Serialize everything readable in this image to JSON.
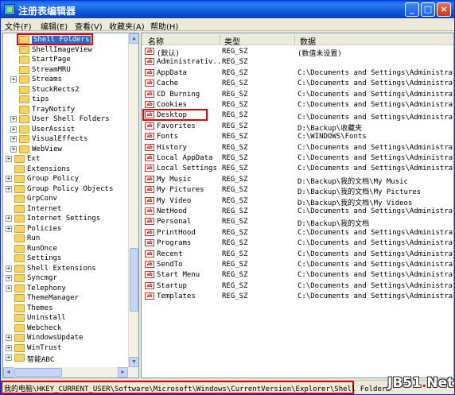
{
  "window": {
    "title": "注册表编辑器",
    "controls": {
      "minimize": "_",
      "maximize": "□",
      "close": "×"
    }
  },
  "menu": [
    "文件(F)",
    "编辑(E)",
    "查看(V)",
    "收藏夹(A)",
    "帮助(H)"
  ],
  "tree": {
    "items": [
      {
        "label": "Shell Folders",
        "indent": 1,
        "expander": "",
        "selected": true
      },
      {
        "label": "ShellImageView",
        "indent": 1,
        "expander": ""
      },
      {
        "label": "StartPage",
        "indent": 1,
        "expander": ""
      },
      {
        "label": "StreamMRU",
        "indent": 1,
        "expander": ""
      },
      {
        "label": "Streams",
        "indent": 1,
        "expander": "+"
      },
      {
        "label": "StuckRects2",
        "indent": 1,
        "expander": ""
      },
      {
        "label": "tips",
        "indent": 1,
        "expander": ""
      },
      {
        "label": "TrayNotify",
        "indent": 1,
        "expander": ""
      },
      {
        "label": "User Shell Folders",
        "indent": 1,
        "expander": "+"
      },
      {
        "label": "UserAssist",
        "indent": 1,
        "expander": "+"
      },
      {
        "label": "VisualEffects",
        "indent": 1,
        "expander": "+"
      },
      {
        "label": "WebView",
        "indent": 1,
        "expander": "+"
      },
      {
        "label": "Ext",
        "indent": 0,
        "expander": "+"
      },
      {
        "label": "Extensions",
        "indent": 0,
        "expander": ""
      },
      {
        "label": "Group Policy",
        "indent": 0,
        "expander": "+"
      },
      {
        "label": "Group Policy Objects",
        "indent": 0,
        "expander": "+"
      },
      {
        "label": "GrpConv",
        "indent": 0,
        "expander": ""
      },
      {
        "label": "Internet",
        "indent": 0,
        "expander": ""
      },
      {
        "label": "Internet Settings",
        "indent": 0,
        "expander": "+"
      },
      {
        "label": "Policies",
        "indent": 0,
        "expander": "+"
      },
      {
        "label": "Run",
        "indent": 0,
        "expander": ""
      },
      {
        "label": "RunOnce",
        "indent": 0,
        "expander": ""
      },
      {
        "label": "Settings",
        "indent": 0,
        "expander": ""
      },
      {
        "label": "Shell Extensions",
        "indent": 0,
        "expander": "+"
      },
      {
        "label": "Syncmgr",
        "indent": 0,
        "expander": "+"
      },
      {
        "label": "Telephony",
        "indent": 0,
        "expander": "+"
      },
      {
        "label": "ThemeManager",
        "indent": 0,
        "expander": ""
      },
      {
        "label": "Themes",
        "indent": 0,
        "expander": ""
      },
      {
        "label": "Uninstall",
        "indent": 0,
        "expander": ""
      },
      {
        "label": "Webcheck",
        "indent": 0,
        "expander": ""
      },
      {
        "label": "WindowsUpdate",
        "indent": 0,
        "expander": "+"
      },
      {
        "label": "WinTrust",
        "indent": 0,
        "expander": "+"
      },
      {
        "label": "智能ABC",
        "indent": 0,
        "expander": "+"
      }
    ]
  },
  "list": {
    "columns": {
      "name": "名称",
      "type": "类型",
      "data": "数据"
    },
    "rows": [
      {
        "name": "(默认)",
        "type": "REG_SZ",
        "data": "(数值未设置)"
      },
      {
        "name": "Administrativ...",
        "type": "REG_SZ",
        "data": ""
      },
      {
        "name": "AppData",
        "type": "REG_SZ",
        "data": "C:\\Documents and Settings\\Administrator\\A"
      },
      {
        "name": "Cache",
        "type": "REG_SZ",
        "data": "C:\\Documents and Settings\\Administrator\\L"
      },
      {
        "name": "CD Burning",
        "type": "REG_SZ",
        "data": "C:\\Documents and Settings\\Administrator\\L"
      },
      {
        "name": "Cookies",
        "type": "REG_SZ",
        "data": "C:\\Documents and Settings\\Administrator\\C"
      },
      {
        "name": "Desktop",
        "type": "REG_SZ",
        "data": "C:\\Documents and Settings\\Administrator\\桌",
        "highlight": true
      },
      {
        "name": "Favorites",
        "type": "REG_SZ",
        "data": "D:\\Backup\\收藏夹"
      },
      {
        "name": "Fonts",
        "type": "REG_SZ",
        "data": "C:\\WINDOWS\\Fonts"
      },
      {
        "name": "History",
        "type": "REG_SZ",
        "data": "C:\\Documents and Settings\\Administrator\\L"
      },
      {
        "name": "Local AppData",
        "type": "REG_SZ",
        "data": "C:\\Documents and Settings\\Administrator\\L"
      },
      {
        "name": "Local Settings",
        "type": "REG_SZ",
        "data": "C:\\Documents and Settings\\Administrator\\L"
      },
      {
        "name": "My Music",
        "type": "REG_SZ",
        "data": "D:\\Backup\\我的文档\\My Music"
      },
      {
        "name": "My Pictures",
        "type": "REG_SZ",
        "data": "D:\\Backup\\我的文档\\My Pictures"
      },
      {
        "name": "My Video",
        "type": "REG_SZ",
        "data": "D:\\Backup\\我的文档\\My Videos"
      },
      {
        "name": "NetHood",
        "type": "REG_SZ",
        "data": "C:\\Documents and Settings\\Administrator\\N"
      },
      {
        "name": "Personal",
        "type": "REG_SZ",
        "data": "D:\\Backup\\我的文档"
      },
      {
        "name": "PrintHood",
        "type": "REG_SZ",
        "data": "C:\\Documents and Settings\\Administrator\\P"
      },
      {
        "name": "Programs",
        "type": "REG_SZ",
        "data": "C:\\Documents and Settings\\Administrator\\"
      },
      {
        "name": "Recent",
        "type": "REG_SZ",
        "data": "C:\\Documents and Settings\\Administrator\\R"
      },
      {
        "name": "SendTo",
        "type": "REG_SZ",
        "data": "C:\\Documents and Settings\\Administrator\\S"
      },
      {
        "name": "Start Menu",
        "type": "REG_SZ",
        "data": "C:\\Documents and Settings\\Administrator\\"
      },
      {
        "name": "Startup",
        "type": "REG_SZ",
        "data": "C:\\Documents and Settings\\Administrator\\"
      },
      {
        "name": "Templates",
        "type": "REG_SZ",
        "data": "C:\\Documents and Settings\\Administrator\\T"
      }
    ]
  },
  "status": {
    "path": "我的电脑\\HKEY_CURRENT_USER\\Software\\Microsoft\\Windows\\CurrentVersion\\Explorer\\Shell Folders"
  },
  "watermark": {
    "main": "JB51",
    "dot": ".",
    "suffix": "Net"
  },
  "colors": {
    "title_bar": "#0b54d6",
    "selection": "#316ac5",
    "highlight_box": "#e00000",
    "folder": "#f4d46a"
  }
}
